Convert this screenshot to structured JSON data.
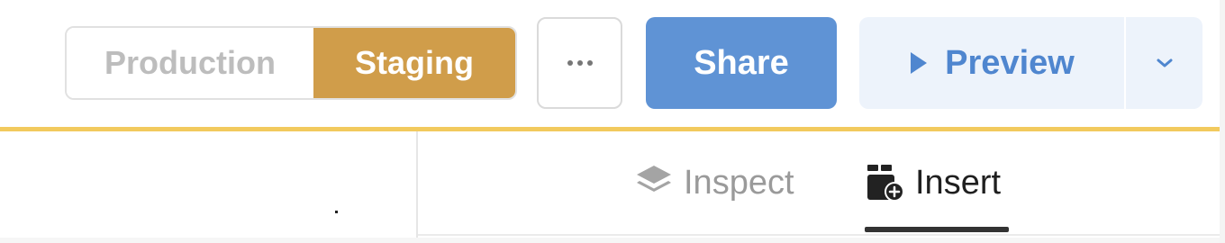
{
  "environment": {
    "production_label": "Production",
    "staging_label": "Staging",
    "active": "Staging"
  },
  "toolbar": {
    "share_label": "Share",
    "preview_label": "Preview"
  },
  "panel": {
    "tabs": [
      {
        "label": "Inspect",
        "active": false
      },
      {
        "label": "Insert",
        "active": true
      }
    ]
  },
  "colors": {
    "staging": "#d09d4a",
    "share": "#5f93d5",
    "preview_text": "#4f86cf",
    "accent_line": "#f2ca5e"
  },
  "icons": {
    "more": "more-horizontal-icon",
    "preview": "play-icon",
    "dropdown": "chevron-down-icon",
    "inspect": "layers-icon",
    "insert": "insert-component-icon"
  }
}
